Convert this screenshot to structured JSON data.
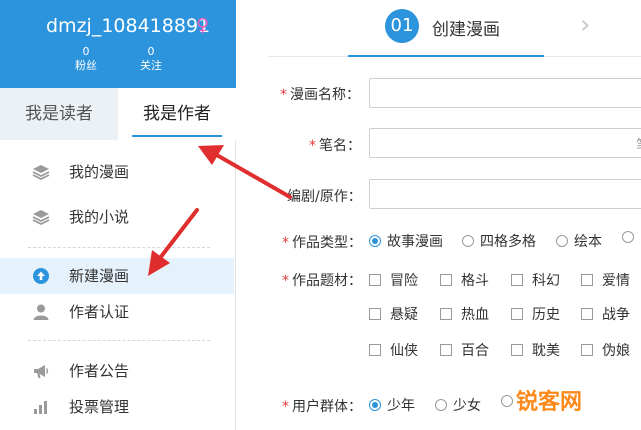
{
  "profile": {
    "username": "dmzj_108418891",
    "gender_symbol": "♀",
    "fans_count": "0",
    "fans_label": "粉丝",
    "follow_count": "0",
    "follow_label": "关注"
  },
  "tabs": {
    "reader": "我是读者",
    "author": "我是作者"
  },
  "menu": [
    {
      "label": "我的漫画"
    },
    {
      "label": "我的小说"
    },
    {
      "label": "新建漫画"
    },
    {
      "label": "作者认证"
    },
    {
      "label": "作者公告"
    },
    {
      "label": "投票管理"
    }
  ],
  "step": {
    "number": "01",
    "label": "创建漫画",
    "next_arrow": "›"
  },
  "form": {
    "required_mark": "*",
    "title_label": "漫画名称：",
    "pen_name_label": "笔名：",
    "writer_label": "编剧/原作：",
    "side_char": "笔",
    "type_label": "作品类型：",
    "type_options": [
      {
        "label": "故事漫画",
        "checked": true
      },
      {
        "label": "四格多格",
        "checked": false
      },
      {
        "label": "绘本",
        "checked": false
      }
    ],
    "theme_label": "作品题材：",
    "themes": [
      "冒险",
      "格斗",
      "科幻",
      "爱情",
      "悬疑",
      "热血",
      "历史",
      "战争",
      "仙侠",
      "百合",
      "耽美",
      "伪娘"
    ],
    "audience_label": "用户群体：",
    "audience_options": [
      {
        "label": "少年",
        "checked": true
      },
      {
        "label": "少女",
        "checked": false
      }
    ]
  },
  "watermark": "锐客网",
  "colors": {
    "accent": "#2c94dc",
    "required": "#e4393c",
    "arrow": "#e02d2d",
    "watermark": "#ff8a1c"
  }
}
